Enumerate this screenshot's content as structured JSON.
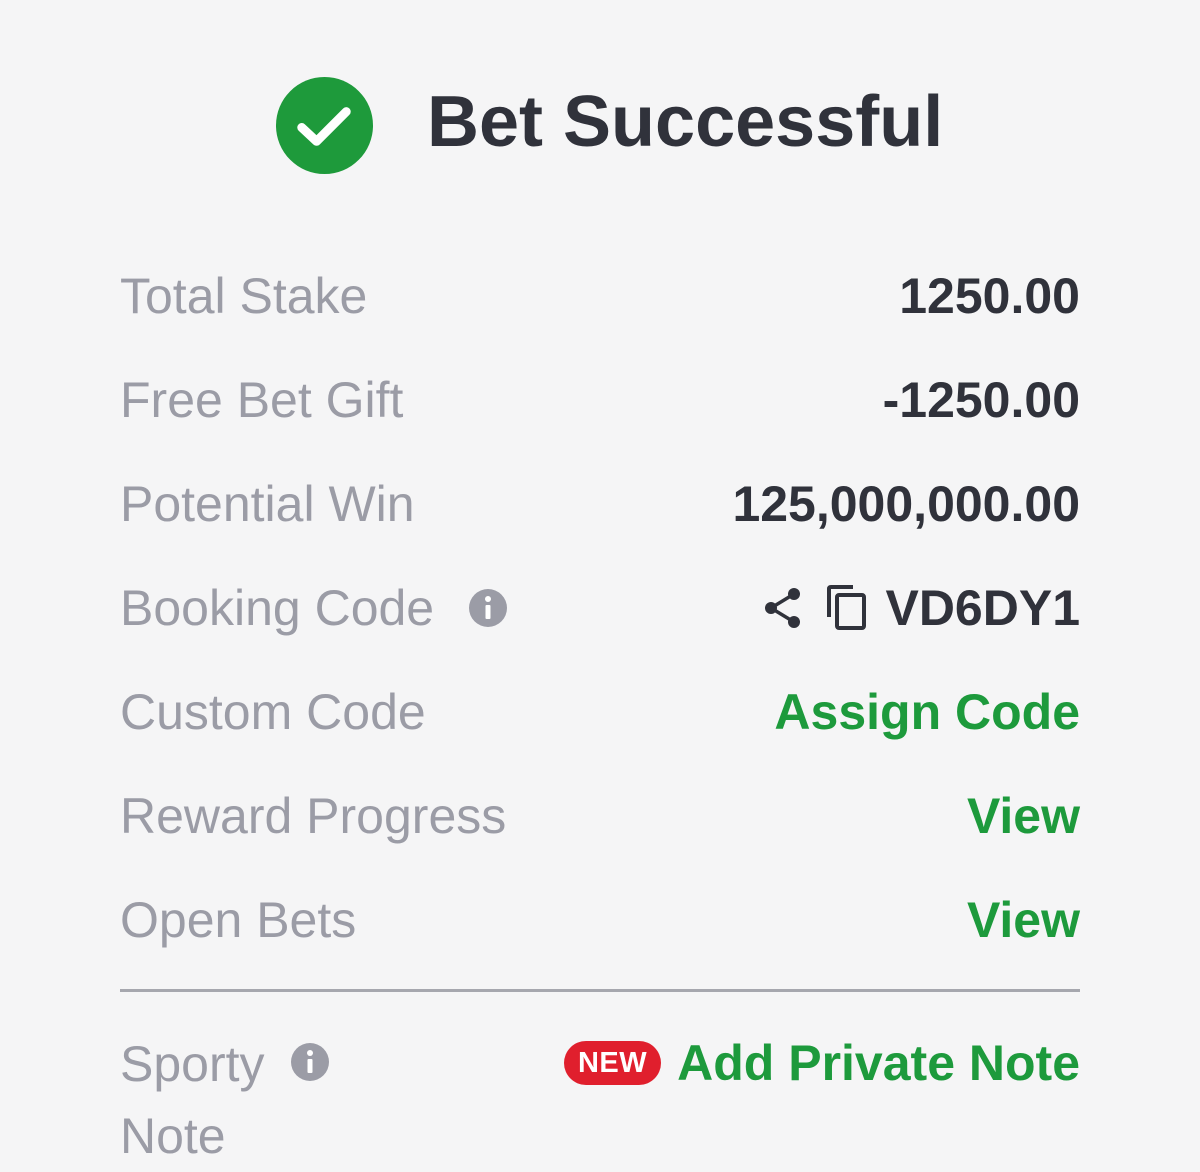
{
  "header": {
    "title": "Bet Successful",
    "icon": "check-circle-icon",
    "accent": "#1e9a3b"
  },
  "rows": [
    {
      "label": "Total Stake",
      "value": "1250.00"
    },
    {
      "label": "Free Bet Gift",
      "value": "-1250.00"
    },
    {
      "label": "Potential Win",
      "value": "125,000,000.00"
    },
    {
      "label": "Booking Code",
      "value": "VD6DY1",
      "label_icon": "info-icon",
      "value_icons": [
        "share-icon",
        "copy-icon"
      ]
    },
    {
      "label": "Custom Code",
      "value": "Assign Code"
    },
    {
      "label": "Reward Progress",
      "value": "View"
    },
    {
      "label": "Open Bets",
      "value": "View"
    }
  ],
  "note": {
    "label_line1": "Sporty",
    "label_line2": "Note",
    "badge": "NEW",
    "action": "Add Private Note",
    "badge_color": "#e01f2d"
  },
  "colors": {
    "label": "#9b9ca6",
    "value": "#30323b",
    "link": "#1d9a3c",
    "background": "#f5f5f6"
  }
}
